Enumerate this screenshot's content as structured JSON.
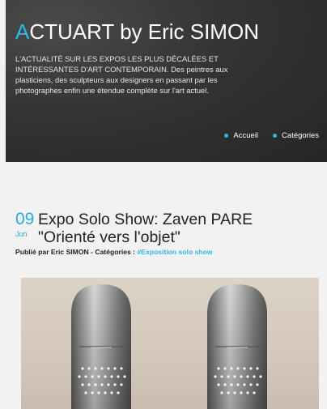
{
  "header": {
    "title_first_letter": "A",
    "title_rest": "CTUART by Eric SIMON",
    "tagline": "L'ACTUALITÉ SUR LES EXPOS LES PLUS DÉCALÉES ET INTÉRESSANTES D'ART CONTEMPORAIN. Des peintres aux plasticiens, des sculpteurs aux designers en passant par les photographes enfin une étendue complète sur l'art actuel.",
    "nav": [
      {
        "label": "Accueil",
        "icon": "bullet-dot-icon"
      },
      {
        "label": "Catégories",
        "icon": "bullet-dot-icon"
      }
    ]
  },
  "post": {
    "day": "09",
    "month": "Jun",
    "title": "Expo Solo Show: Zaven PARE \"Orienté vers l'objet\"",
    "meta_prefix": "Publié par Eric SIMON  - Catégories : ",
    "category": "#Exposition solo show"
  },
  "colors": {
    "accent": "#31b6ea",
    "header_bg": "#333333",
    "page_bg": "#f2f2f2"
  }
}
